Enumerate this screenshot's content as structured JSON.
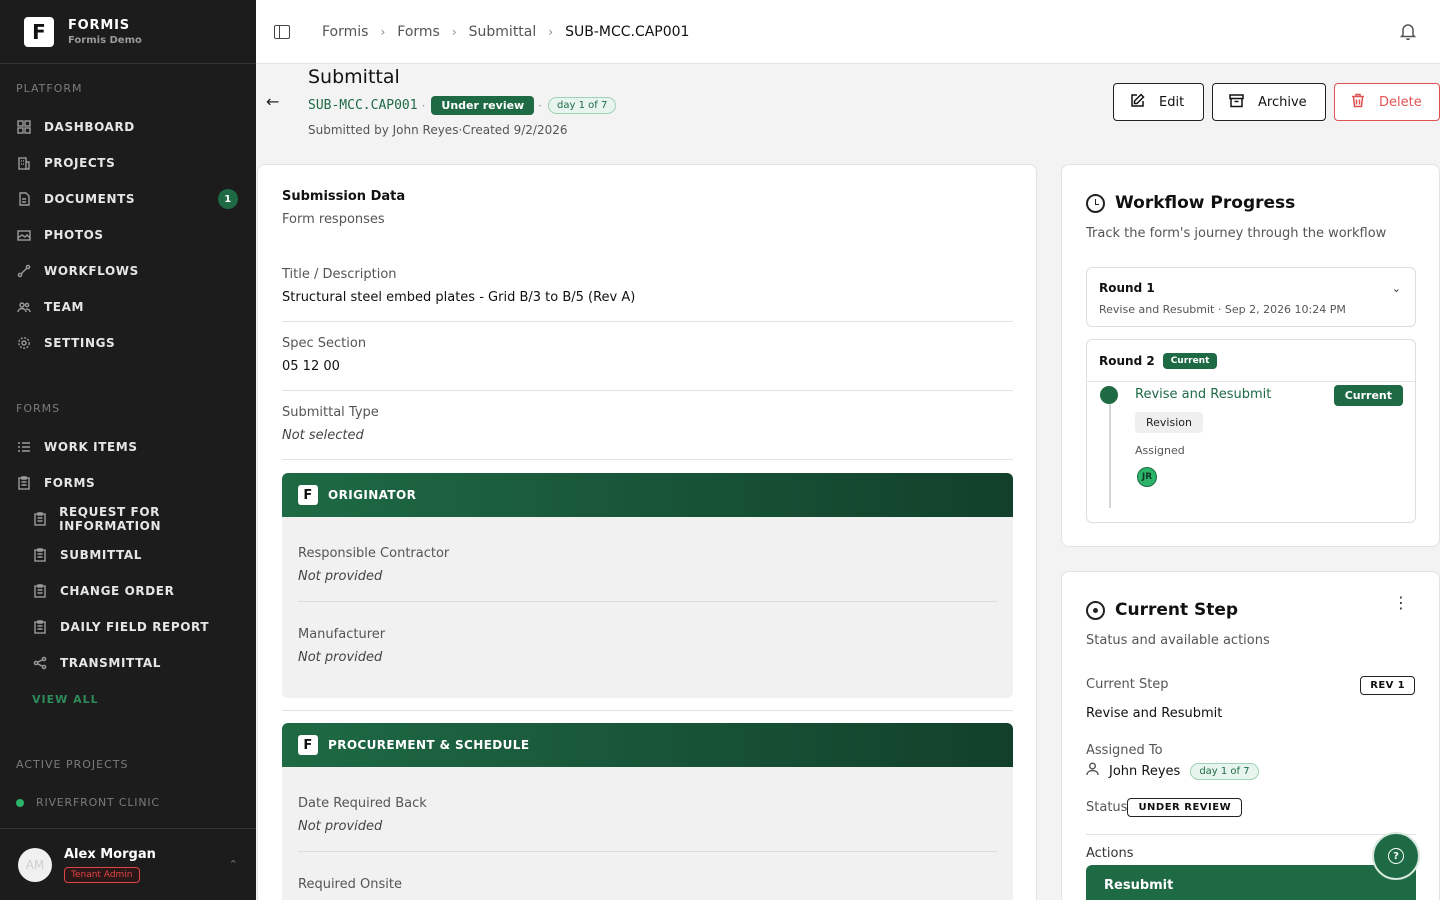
{
  "brand": {
    "name": "FORMIS",
    "subtitle": "Formis Demo",
    "logo_letter": "F"
  },
  "sidebar": {
    "platform_title": "PLATFORM",
    "platform_items": [
      {
        "label": "DASHBOARD",
        "icon": "grid-icon"
      },
      {
        "label": "PROJECTS",
        "icon": "building-icon"
      },
      {
        "label": "DOCUMENTS",
        "icon": "document-icon",
        "badge": "1"
      },
      {
        "label": "PHOTOS",
        "icon": "photos-icon"
      },
      {
        "label": "WORKFLOWS",
        "icon": "workflow-icon"
      },
      {
        "label": "TEAM",
        "icon": "team-icon"
      },
      {
        "label": "SETTINGS",
        "icon": "gear-icon"
      }
    ],
    "forms_title": "FORMS",
    "forms_items": [
      {
        "label": "WORK ITEMS",
        "icon": "list-icon"
      },
      {
        "label": "FORMS",
        "icon": "clipboard-icon"
      }
    ],
    "forms_subitems": [
      {
        "label": "REQUEST FOR INFORMATION",
        "icon": "clipboard-icon"
      },
      {
        "label": "SUBMITTAL",
        "icon": "clipboard-icon"
      },
      {
        "label": "CHANGE ORDER",
        "icon": "clipboard-icon"
      },
      {
        "label": "DAILY FIELD REPORT",
        "icon": "clipboard-icon"
      },
      {
        "label": "TRANSMITTAL",
        "icon": "share-icon"
      }
    ],
    "view_all": "VIEW ALL",
    "active_projects_title": "ACTIVE PROJECTS",
    "active_project": "RIVERFRONT CLINIC",
    "user": {
      "initials": "AM",
      "name": "Alex Morgan",
      "role": "Tenant Admin"
    }
  },
  "breadcrumbs": [
    "Formis",
    "Forms",
    "Submittal",
    "SUB-MCC.CAP001"
  ],
  "header": {
    "title": "Submittal",
    "code": "SUB-MCC.CAP001",
    "status": "Under review",
    "day": "day 1 of 7",
    "submitted_by": "Submitted by John Reyes",
    "created": "Created 9/2/2026",
    "edit_label": "Edit",
    "archive_label": "Archive",
    "delete_label": "Delete"
  },
  "submission": {
    "title": "Submission Data",
    "subtitle": "Form responses",
    "fields": [
      {
        "label": "Title / Description",
        "value": "Structural steel embed plates - Grid B/3 to B/5 (Rev A)"
      },
      {
        "label": "Spec Section",
        "value": "05 12 00"
      },
      {
        "label": "Submittal Type",
        "value": "Not selected"
      }
    ],
    "groups": [
      {
        "title": "ORIGINATOR",
        "fields": [
          {
            "label": "Responsible Contractor",
            "value": "Not provided"
          },
          {
            "label": "Manufacturer",
            "value": "Not provided"
          }
        ]
      },
      {
        "title": "PROCUREMENT & SCHEDULE",
        "fields": [
          {
            "label": "Date Required Back",
            "value": "Not provided"
          },
          {
            "label": "Required Onsite",
            "value": ""
          }
        ]
      }
    ]
  },
  "workflow": {
    "title": "Workflow Progress",
    "subtitle": "Track the form's journey through the workflow",
    "round1": {
      "title": "Round 1",
      "meta": "Revise and Resubmit · Sep 2, 2026 10:24 PM"
    },
    "round2": {
      "title": "Round 2",
      "badge": "Current",
      "step": "Revise and Resubmit",
      "step_badge": "Current",
      "tag": "Revision",
      "assigned_label": "Assigned",
      "assignee_initials": "JR"
    }
  },
  "current_step": {
    "title": "Current Step",
    "subtitle": "Status and available actions",
    "current_step_label": "Current Step",
    "rev": "REV 1",
    "current_step_value": "Revise and Resubmit",
    "assigned_to_label": "Assigned To",
    "assignee": "John Reyes",
    "day": "day 1 of 7",
    "status_label": "Status",
    "status": "UNDER REVIEW",
    "actions_label": "Actions",
    "resubmit_label": "Resubmit"
  },
  "colors": {
    "accent": "#1e6a45",
    "sidebar_bg": "#1c1c1c",
    "danger": "#e05252"
  }
}
